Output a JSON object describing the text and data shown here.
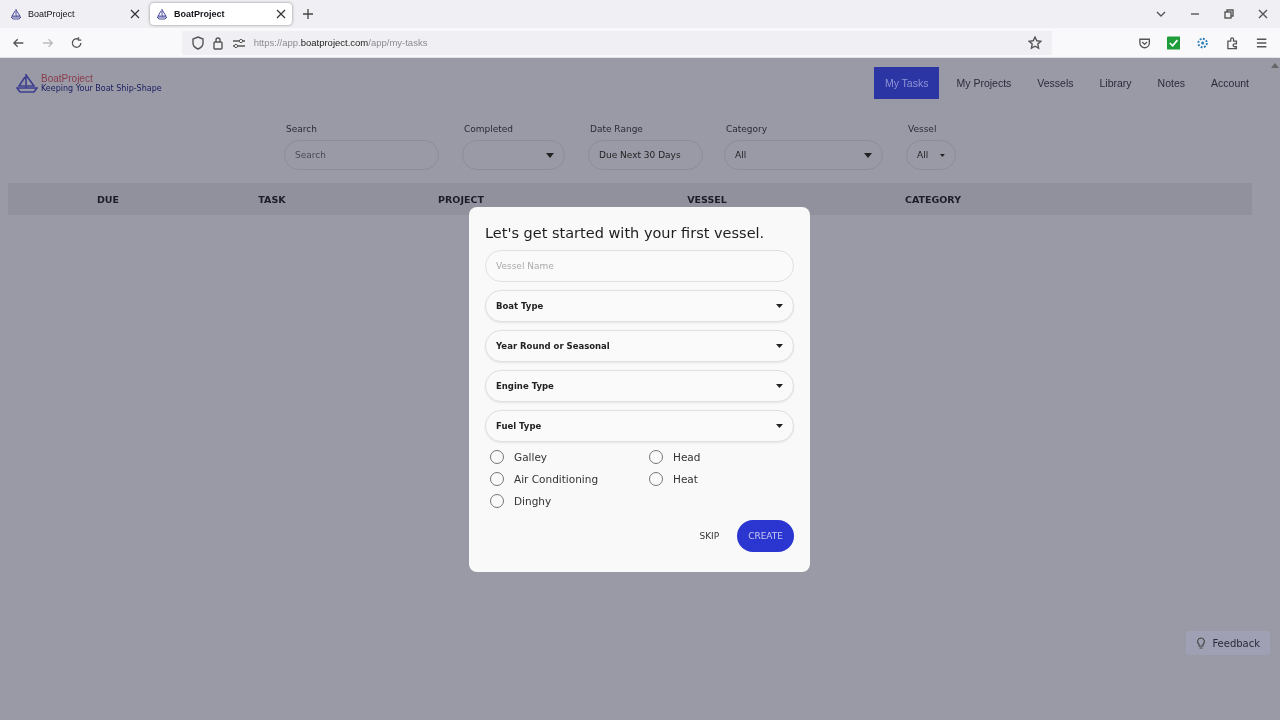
{
  "browser": {
    "tabs": [
      {
        "title": "BoatProject",
        "selected": false
      },
      {
        "title": "BoatProject",
        "selected": true
      }
    ],
    "url": {
      "scheme": "https://app.",
      "domain": "boatproject.com",
      "path": "/app/my-tasks"
    }
  },
  "header": {
    "logo": {
      "name": "BoatProject",
      "tagline": "Keeping Your Boat Ship-Shape"
    },
    "nav": [
      {
        "label": "My Tasks",
        "selected": true
      },
      {
        "label": "My Projects",
        "selected": false
      },
      {
        "label": "Vessels",
        "selected": false
      },
      {
        "label": "Library",
        "selected": false
      },
      {
        "label": "Notes",
        "selected": false
      },
      {
        "label": "Account",
        "selected": false
      }
    ]
  },
  "filters": [
    {
      "kind": "text",
      "label": "Search",
      "placeholder": "Search"
    },
    {
      "kind": "select",
      "label": "Completed"
    },
    {
      "kind": "select",
      "label": "Date Range",
      "value": "Due Next 30 Days"
    },
    {
      "kind": "select",
      "label": "Category",
      "value": "All"
    },
    {
      "kind": "select",
      "label": "Vessel",
      "value": "All"
    }
  ],
  "table": {
    "columns": [
      "DUE",
      "TASK",
      "PROJECT",
      "VESSEL",
      "CATEGORY"
    ]
  },
  "modal": {
    "title": "Let's get started with your first vessel.",
    "fields": [
      {
        "kind": "text",
        "placeholder": "Vessel Name"
      },
      {
        "kind": "select",
        "label": "Boat Type"
      },
      {
        "kind": "select",
        "label": "Year Round or Seasonal"
      },
      {
        "kind": "select",
        "label": "Engine Type"
      },
      {
        "kind": "select",
        "label": "Fuel Type"
      }
    ],
    "options": [
      {
        "label": "Galley",
        "checked": false
      },
      {
        "label": "Head",
        "checked": false
      },
      {
        "label": "Air Conditioning",
        "checked": false
      },
      {
        "label": "Heat",
        "checked": false
      },
      {
        "label": "Dinghy",
        "checked": false
      }
    ],
    "buttons": [
      {
        "kind": "text",
        "label": "SKIP"
      },
      {
        "kind": "primary",
        "label": "CREATE"
      }
    ]
  },
  "feedback": {
    "label": "Feedback"
  }
}
